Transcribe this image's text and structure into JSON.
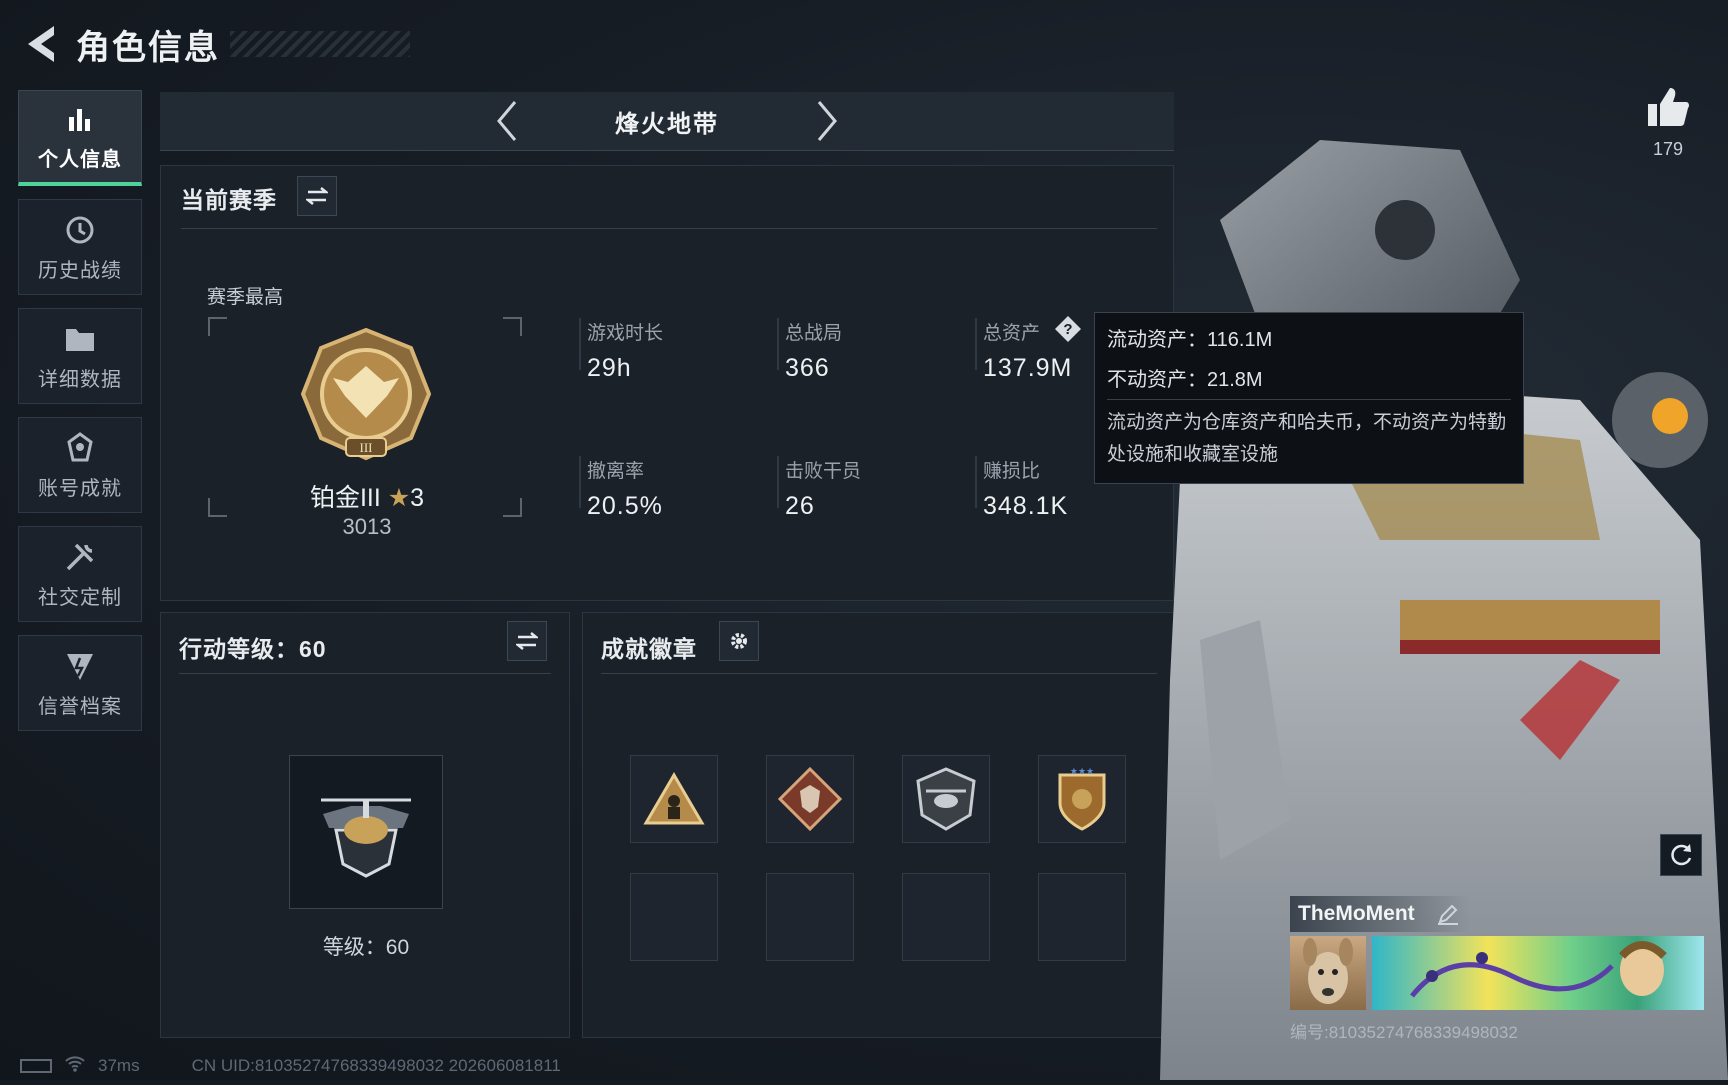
{
  "header": {
    "title": "角色信息"
  },
  "sidebar": {
    "items": [
      {
        "label": "个人信息",
        "icon": "bar-chart-icon",
        "active": true
      },
      {
        "label": "历史战绩",
        "icon": "history-icon"
      },
      {
        "label": "详细数据",
        "icon": "folder-icon"
      },
      {
        "label": "账号成就",
        "icon": "achievement-icon"
      },
      {
        "label": "社交定制",
        "icon": "tools-icon"
      },
      {
        "label": "信誉档案",
        "icon": "shield-icon"
      }
    ]
  },
  "mode": {
    "name": "烽火地带"
  },
  "season": {
    "title": "当前赛季",
    "best_label": "赛季最高",
    "rank_name": "铂金III",
    "rank_stars": "3",
    "rank_points": "3013",
    "stats": [
      {
        "label": "游戏时长",
        "value": "29h"
      },
      {
        "label": "总战局",
        "value": "366"
      },
      {
        "label": "总资产",
        "value": "137.9M"
      },
      {
        "label": "撤离率",
        "value": "20.5%"
      },
      {
        "label": "击败干员",
        "value": "26"
      },
      {
        "label": "赚损比",
        "value": "348.1K"
      }
    ]
  },
  "tooltip": {
    "liquid": "流动资产：116.1M",
    "fixed": "不动资产：21.8M",
    "desc": "流动资产为仓库资产和哈夫币，不动资产为特勤处设施和收藏室设施"
  },
  "action_level": {
    "title": "行动等级：60",
    "level_text": "等级：60"
  },
  "achievements": {
    "title": "成就徽章"
  },
  "profile": {
    "likes": "179",
    "player_name": "TheMoMent",
    "player_id": "编号:8103527476833949803​2"
  },
  "footer": {
    "ping": "37ms",
    "uid": "CN UID:8103527476833949803​2 202606081811"
  },
  "colors": {
    "accent": "#4fd39a",
    "gold": "#c9a25a"
  }
}
